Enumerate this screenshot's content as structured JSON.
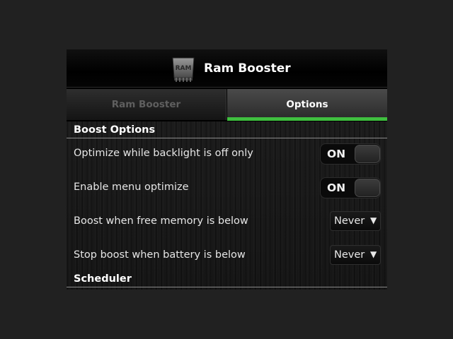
{
  "app": {
    "title": "Ram Booster",
    "icon_label": "RAM"
  },
  "tabs": [
    {
      "label": "Ram Booster",
      "active": false
    },
    {
      "label": "Options",
      "active": true
    }
  ],
  "sections": {
    "boost_options": {
      "title": "Boost Options",
      "rows": [
        {
          "label": "Optimize while backlight is off only",
          "control": "toggle",
          "value": "ON"
        },
        {
          "label": "Enable menu optimize",
          "control": "toggle",
          "value": "ON"
        },
        {
          "label": "Boost when free memory is below",
          "control": "select",
          "value": "Never"
        },
        {
          "label": "Stop boost when battery is below",
          "control": "select",
          "value": "Never"
        }
      ]
    },
    "scheduler": {
      "title": "Scheduler"
    }
  },
  "colors": {
    "active_tab_indicator": "#3fbf3f",
    "scroll_indicator": "#1e90ff"
  },
  "icons": {
    "app_icon": "ram-chip-icon",
    "select_arrow": "triangle-down-icon",
    "scroll": "scroll-down-icon"
  }
}
